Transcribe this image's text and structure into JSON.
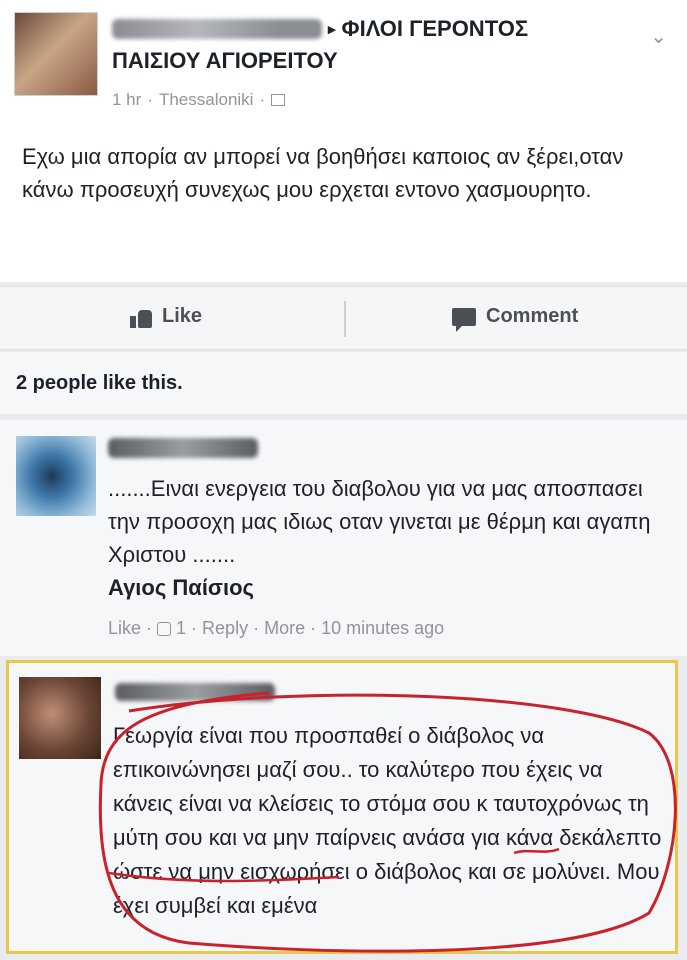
{
  "post": {
    "group_arrow": "▸",
    "group_name_line1": "ΦΙΛΟΙ ΓΕΡΟΝΤΟΣ",
    "group_name_line2": "ΠΑΙΣΙΟΥ ΑΓΙΟΡΕΙΤΟΥ",
    "time": "1 hr",
    "separator": "·",
    "location": "Thessaloniki",
    "text": "Εχω μια απορία αν μπορεί να βοηθήσει καποιος αν ξέρει,οταν κάνω προσευχή συνεχως μου ερχεται εντονο χασμουρητο."
  },
  "actions": {
    "like_label": "Like",
    "comment_label": "Comment"
  },
  "likes_summary": "2 people like this.",
  "comment1": {
    "text": ".......Ειναι ενεργεια του διαβολου για να μας αποσπασει την προσοχη μας ιδιως οταν γινεται με θέρμη και αγαπη Χριστου .......",
    "author_quote": "Αγιος Παίσιος",
    "meta": {
      "like": "Like",
      "dot1": "·",
      "like_count": "1",
      "dot2": "·",
      "reply": "Reply",
      "dot3": "·",
      "more": "More",
      "dot4": "·",
      "time": "10 minutes ago"
    }
  },
  "comment2": {
    "text": "Γεωργία είναι που προσπαθεί ο διάβολος να επικοινώνησει μαζί σου.. το καλύτερο που έχεις να κάνεις είναι να κλείσεις το στόμα σου κ ταυτοχρόνως τη μύτη σου και να μην παίρνεις ανάσα για κάνα δεκάλεπτο ώστε να μην εισχωρήσει ο διάβολος και σε μολύνει. Μου έχει συμβεί και εμένα"
  },
  "colors": {
    "highlight_border": "#e6c94a",
    "annotation_red": "#c8232c"
  },
  "icons": [
    "chevron-down-icon",
    "globe-icon",
    "thumb-up-icon",
    "speech-bubble-icon",
    "small-like-icon"
  ]
}
